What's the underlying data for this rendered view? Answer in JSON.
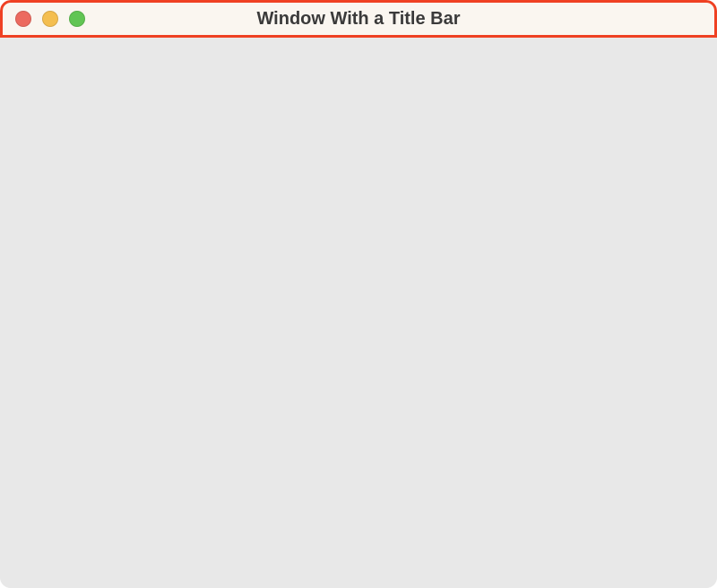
{
  "window": {
    "title": "Window With a Title Bar"
  },
  "traffic_lights": {
    "close_color": "#ec6a5f",
    "minimize_color": "#f4be4f",
    "zoom_color": "#61c554"
  },
  "highlight": {
    "border_color": "#ef4123"
  }
}
